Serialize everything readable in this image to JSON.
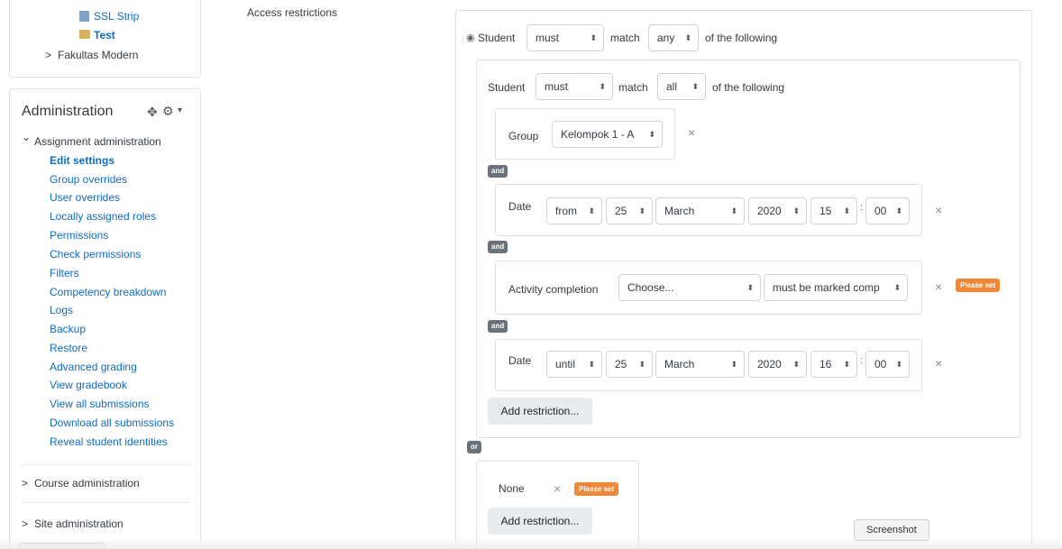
{
  "sidebar_top": {
    "items": [
      {
        "label": "SSL Strip",
        "icon": "file-icon"
      },
      {
        "label": "Test",
        "icon": "folder-icon"
      },
      {
        "label": "Fakultas Modern",
        "chevron": ">"
      }
    ]
  },
  "administration": {
    "title": "Administration",
    "move_glyph": "✥",
    "gear_glyph": "⚙",
    "caret_glyph": "▾",
    "section_expanded": {
      "chevron": "⌄",
      "label": "Assignment administration"
    },
    "links": [
      "Edit settings",
      "Group overrides",
      "User overrides",
      "Locally assigned roles",
      "Permissions",
      "Check permissions",
      "Filters",
      "Competency breakdown",
      "Logs",
      "Backup",
      "Restore",
      "Advanced grading",
      "View gradebook",
      "View all submissions",
      "Download all submissions",
      "Reveal student identities"
    ],
    "course_admin": {
      "chevron": ">",
      "label": "Course administration"
    },
    "site_admin": {
      "chevron": ">",
      "label": "Site administration"
    }
  },
  "main": {
    "section_label": "Access restrictions",
    "root": {
      "eye_glyph": "◉",
      "student_label": "Student",
      "must_value": "must",
      "match_label": "match",
      "any_value": "any",
      "following_label": "of the following"
    },
    "nested": {
      "student_label": "Student",
      "must_value": "must",
      "match_label": "match",
      "all_value": "all",
      "following_label": "of the following",
      "group": {
        "label": "Group",
        "value": "Kelompok 1 - A"
      },
      "and_label": "and",
      "date1": {
        "label": "Date",
        "direction": "from",
        "day": "25",
        "month": "March",
        "year": "2020",
        "hour": "15",
        "minute": "00"
      },
      "activity": {
        "label": "Activity completion",
        "choose": "Choose...",
        "status": "must be marked comp",
        "badge": "Please set"
      },
      "date2": {
        "label": "Date",
        "direction": "until",
        "day": "25",
        "month": "March",
        "year": "2020",
        "hour": "16",
        "minute": "00"
      },
      "add_button": "Add restriction..."
    },
    "or_label": "or",
    "second": {
      "none_label": "None",
      "badge": "Please set",
      "add_button": "Add restriction..."
    },
    "close_glyph": "×",
    "arrow_glyph": "⬍",
    "colon": ":"
  },
  "tooltip": "Screenshot"
}
